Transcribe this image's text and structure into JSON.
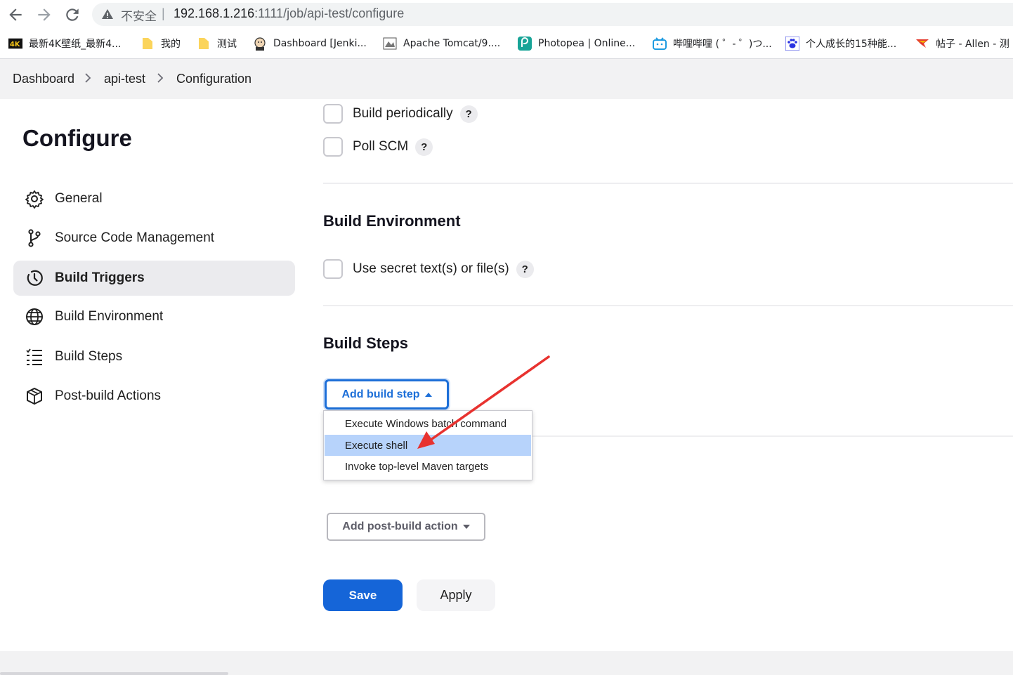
{
  "browser": {
    "security_label": "不安全",
    "separator": "|",
    "url_host": "192.168.1.216",
    "url_rest": ":1111/job/api-test/configure",
    "bookmarks": [
      {
        "label": "最新4K壁纸_最新4...",
        "icon": "4k-logo-icon"
      },
      {
        "label": "我的",
        "icon": "folder-icon"
      },
      {
        "label": "测试",
        "icon": "folder-icon"
      },
      {
        "label": "Dashboard [Jenki...",
        "icon": "jenkins-icon"
      },
      {
        "label": "Apache Tomcat/9....",
        "icon": "tomcat-icon"
      },
      {
        "label": "Photopea | Online...",
        "icon": "photopea-icon"
      },
      {
        "label": "哔哩哔哩 ( ゜- ゜)つ...",
        "icon": "bilibili-icon"
      },
      {
        "label": "个人成长的15种能...",
        "icon": "baidu-paw-icon"
      },
      {
        "label": "帖子 - Allen - 测",
        "icon": "testerhome-icon"
      }
    ]
  },
  "breadcrumb": {
    "items": [
      "Dashboard",
      "api-test",
      "Configuration"
    ]
  },
  "sidebar": {
    "title": "Configure",
    "items": [
      {
        "label": "General",
        "icon": "gear-icon",
        "active": false
      },
      {
        "label": "Source Code Management",
        "icon": "branch-icon",
        "active": false
      },
      {
        "label": "Build Triggers",
        "icon": "clock-icon",
        "active": true
      },
      {
        "label": "Build Environment",
        "icon": "globe-icon",
        "active": false
      },
      {
        "label": "Build Steps",
        "icon": "list-icon",
        "active": false
      },
      {
        "label": "Post-build Actions",
        "icon": "package-icon",
        "active": false
      }
    ]
  },
  "triggers": {
    "build_periodically": "Build periodically",
    "poll_scm": "Poll SCM",
    "help": "?"
  },
  "build_environment": {
    "title": "Build Environment",
    "secret": "Use secret text(s) or file(s)"
  },
  "build_steps": {
    "title": "Build Steps",
    "add_button": "Add build step",
    "menu": [
      {
        "label": "Execute Windows batch command",
        "highlighted": false
      },
      {
        "label": "Execute shell",
        "highlighted": true
      },
      {
        "label": "Invoke top-level Maven targets",
        "highlighted": false
      }
    ]
  },
  "post_build": {
    "add_button": "Add post-build action"
  },
  "actions": {
    "save": "Save",
    "apply": "Apply"
  },
  "colors": {
    "accent": "#1565d8",
    "highlight": "#b7d3fb",
    "annotation_arrow": "#e8322f"
  }
}
